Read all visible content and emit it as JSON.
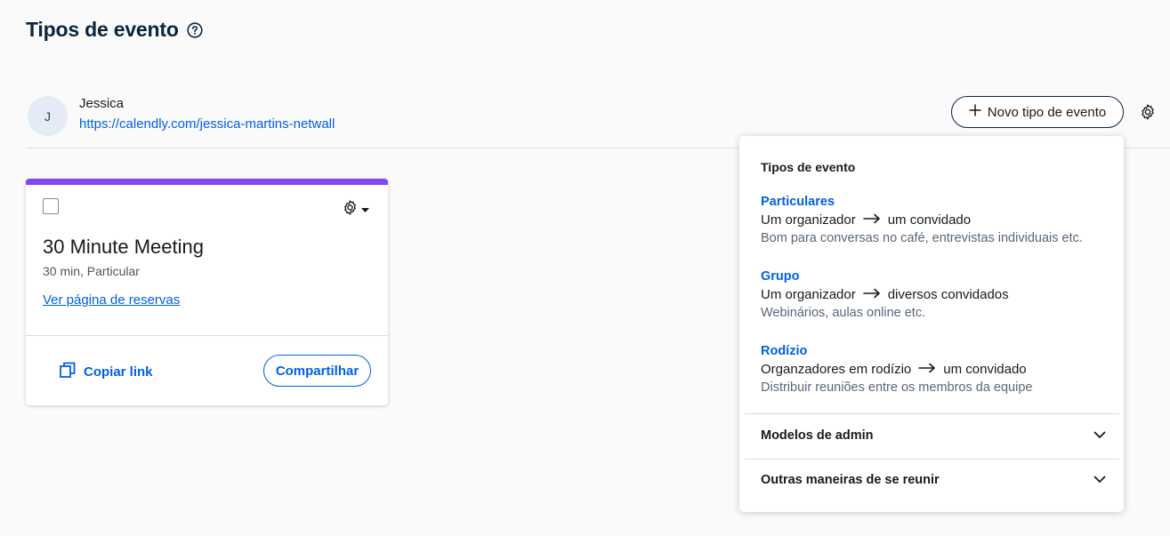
{
  "page": {
    "title": "Tipos de evento"
  },
  "user": {
    "initial": "J",
    "name": "Jessica",
    "link": "https://calendly.com/jessica-martins-netwall"
  },
  "header": {
    "new_event_label": "Novo tipo de evento"
  },
  "event_card": {
    "accent_color": "#8247f5",
    "title": "30 Minute Meeting",
    "subtitle": "30 min, Particular",
    "booking_link": "Ver página de reservas",
    "copy_link": "Copiar link",
    "share": "Compartilhar"
  },
  "dropdown": {
    "heading": "Tipos de evento",
    "options": [
      {
        "title": "Particulares",
        "from": "Um organizador",
        "to": "um convidado",
        "desc": "Bom para conversas no café, entrevistas individuais etc."
      },
      {
        "title": "Grupo",
        "from": "Um organizador",
        "to": "diversos convidados",
        "desc": "Webinários, aulas online etc."
      },
      {
        "title": "Rodízio",
        "from": "Organzadores em rodízio",
        "to": "um convidado",
        "desc": "Distribuir reuniões entre os membros da equipe"
      }
    ],
    "sections": [
      {
        "label": "Modelos de admin"
      },
      {
        "label": "Outras maneiras de se reunir"
      }
    ]
  },
  "colors": {
    "primary": "#0060e6",
    "text_dark": "#0a2540",
    "accent_purple": "#8247f5"
  }
}
